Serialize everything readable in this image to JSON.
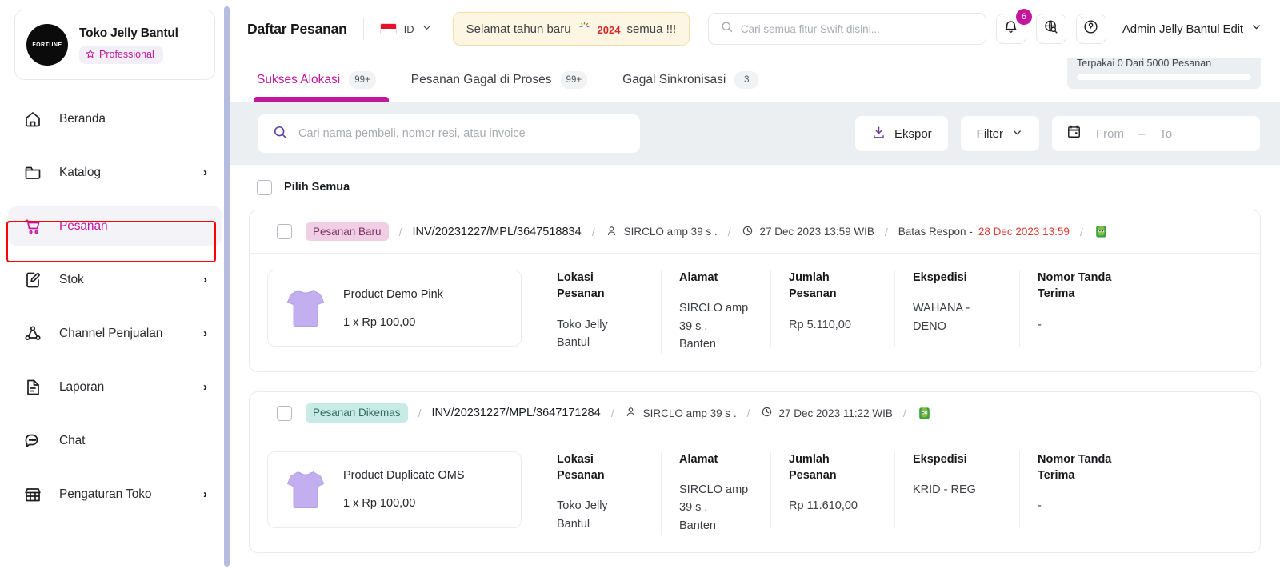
{
  "sidebar": {
    "store": {
      "avatar_text": "FORTUNE",
      "name": "Toko Jelly Bantul",
      "badge": "Professional",
      "badge_icon": "star-icon"
    },
    "items": [
      {
        "label": "Beranda",
        "icon": "home-icon",
        "expandable": false,
        "active": false
      },
      {
        "label": "Katalog",
        "icon": "folder-icon",
        "expandable": true,
        "chevron": "›",
        "active": false
      },
      {
        "label": "Pesanan",
        "icon": "cart-icon",
        "expandable": false,
        "active": true
      },
      {
        "label": "Stok",
        "icon": "edit-document-icon",
        "expandable": true,
        "chevron": "›",
        "active": false
      },
      {
        "label": "Channel Penjualan",
        "icon": "share-nodes-icon",
        "expandable": true,
        "chevron": "›",
        "active": false
      },
      {
        "label": "Laporan",
        "icon": "report-document-icon",
        "expandable": true,
        "chevron": "›",
        "active": false
      },
      {
        "label": "Chat",
        "icon": "chat-bubble-icon",
        "expandable": false,
        "active": false
      },
      {
        "label": "Pengaturan Toko",
        "icon": "store-icon",
        "expandable": true,
        "chevron": "›",
        "active": false
      }
    ]
  },
  "topbar": {
    "title": "Daftar Pesanan",
    "language": {
      "code": "ID",
      "flag": "indonesia-flag-icon",
      "caret": "⌄"
    },
    "banner": {
      "prefix": "Selamat tahun baru",
      "year": "2024",
      "suffix": "semua !!!",
      "icon": "fireworks-icon"
    },
    "search_placeholder": "Cari semua fitur Swift disini...",
    "notification_count": "6",
    "user_name": "Admin Jelly Bantul Edit",
    "user_caret": "⌄"
  },
  "quota": {
    "label": "Terpakai 0 Dari 5000 Pesanan",
    "progress_percent": 0
  },
  "tabs": [
    {
      "label": "Sukses Alokasi",
      "count": "99+",
      "active": true
    },
    {
      "label": "Pesanan Gagal di Proses",
      "count": "99+",
      "active": false
    },
    {
      "label": "Gagal Sinkronisasi",
      "count": "3",
      "active": false
    }
  ],
  "toolbar": {
    "search_placeholder": "Cari nama pembeli, nomor resi, atau invoice",
    "export_label": "Ekspor",
    "filter_label": "Filter",
    "filter_caret": "⌄",
    "date_from_placeholder": "From",
    "date_to_placeholder": "To",
    "date_separator": "–"
  },
  "list": {
    "select_all_label": "Pilih Semua",
    "column_headers": {
      "lokasi": "Lokasi Pesanan",
      "alamat": "Alamat",
      "jumlah": "Jumlah Pesanan",
      "ekspedisi": "Ekspedisi",
      "nomor": "Nomor Tanda Terima"
    },
    "orders": [
      {
        "status": "Pesanan Baru",
        "status_type": "new",
        "invoice": "INV/20231227/MPL/3647518834",
        "buyer": "SIRCLO amp 39 s .",
        "order_time": "27 Dec 2023 13:59 WIB",
        "respond_label": "Batas Respon  -",
        "respond_deadline": "28 Dec 2023 13:59",
        "channel_icon": "tokopedia-icon",
        "product_name": "Product Demo Pink",
        "product_price": "1 x Rp 100,00",
        "lokasi": "Toko Jelly Bantul",
        "alamat": "SIRCLO amp 39 s .\nBanten",
        "jumlah": "Rp 5.110,00",
        "ekspedisi": "WAHANA - DENO",
        "nomor": "-"
      },
      {
        "status": "Pesanan Dikemas",
        "status_type": "packed",
        "invoice": "INV/20231227/MPL/3647171284",
        "buyer": "SIRCLO amp 39 s .",
        "order_time": "27 Dec 2023 11:22 WIB",
        "respond_label": "",
        "respond_deadline": "",
        "channel_icon": "tokopedia-icon",
        "product_name": "Product Duplicate OMS",
        "product_price": "1 x Rp 100,00",
        "lokasi": "Toko Jelly Bantul",
        "alamat": "SIRCLO amp 39 s .\nBanten",
        "jumlah": "Rp 11.610,00",
        "ekspedisi": "KRID - REG",
        "nomor": "-"
      }
    ]
  },
  "colors": {
    "accent": "#c2169c",
    "danger": "#e23a2e",
    "annotation": "#ff0000",
    "toolbar_bg": "#eceff2"
  }
}
